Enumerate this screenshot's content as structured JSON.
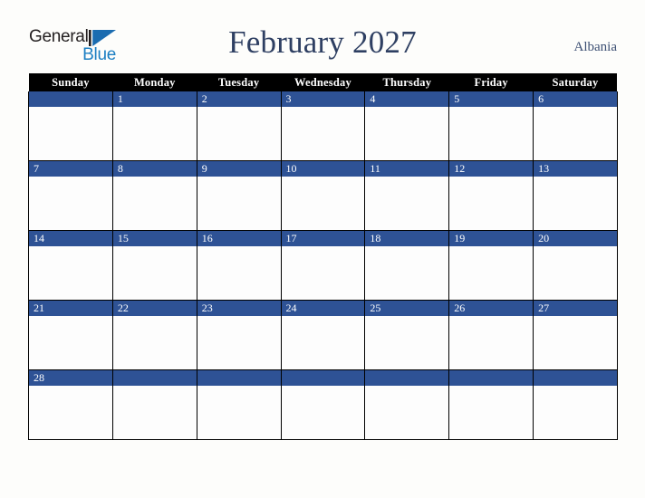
{
  "logo": {
    "line1": "General",
    "line2": "Blue",
    "triangle_icon": "triangle-icon",
    "accent_dark": "#231f20",
    "accent_blue": "#1b7ec2"
  },
  "header": {
    "title": "February 2027",
    "region": "Albania",
    "title_color": "#2e3f62",
    "region_color": "#3c4f73"
  },
  "calendar": {
    "month": "February",
    "year": "2027",
    "weekday_headers": [
      "Sunday",
      "Monday",
      "Tuesday",
      "Wednesday",
      "Thursday",
      "Friday",
      "Saturday"
    ],
    "header_bg": "#000000",
    "header_text": "#ffffff",
    "day_band_bg": "#2e5295",
    "day_band_text": "#ffffff",
    "cell_bg": "#fdfdfd",
    "grid_line": "#000000",
    "weeks": [
      {
        "days": [
          {
            "num": ""
          },
          {
            "num": "1"
          },
          {
            "num": "2"
          },
          {
            "num": "3"
          },
          {
            "num": "4"
          },
          {
            "num": "5"
          },
          {
            "num": "6"
          }
        ]
      },
      {
        "days": [
          {
            "num": "7"
          },
          {
            "num": "8"
          },
          {
            "num": "9"
          },
          {
            "num": "10"
          },
          {
            "num": "11"
          },
          {
            "num": "12"
          },
          {
            "num": "13"
          }
        ]
      },
      {
        "days": [
          {
            "num": "14"
          },
          {
            "num": "15"
          },
          {
            "num": "16"
          },
          {
            "num": "17"
          },
          {
            "num": "18"
          },
          {
            "num": "19"
          },
          {
            "num": "20"
          }
        ]
      },
      {
        "days": [
          {
            "num": "21"
          },
          {
            "num": "22"
          },
          {
            "num": "23"
          },
          {
            "num": "24"
          },
          {
            "num": "25"
          },
          {
            "num": "26"
          },
          {
            "num": "27"
          }
        ]
      },
      {
        "days": [
          {
            "num": "28"
          },
          {
            "num": ""
          },
          {
            "num": ""
          },
          {
            "num": ""
          },
          {
            "num": ""
          },
          {
            "num": ""
          },
          {
            "num": ""
          }
        ]
      }
    ]
  }
}
